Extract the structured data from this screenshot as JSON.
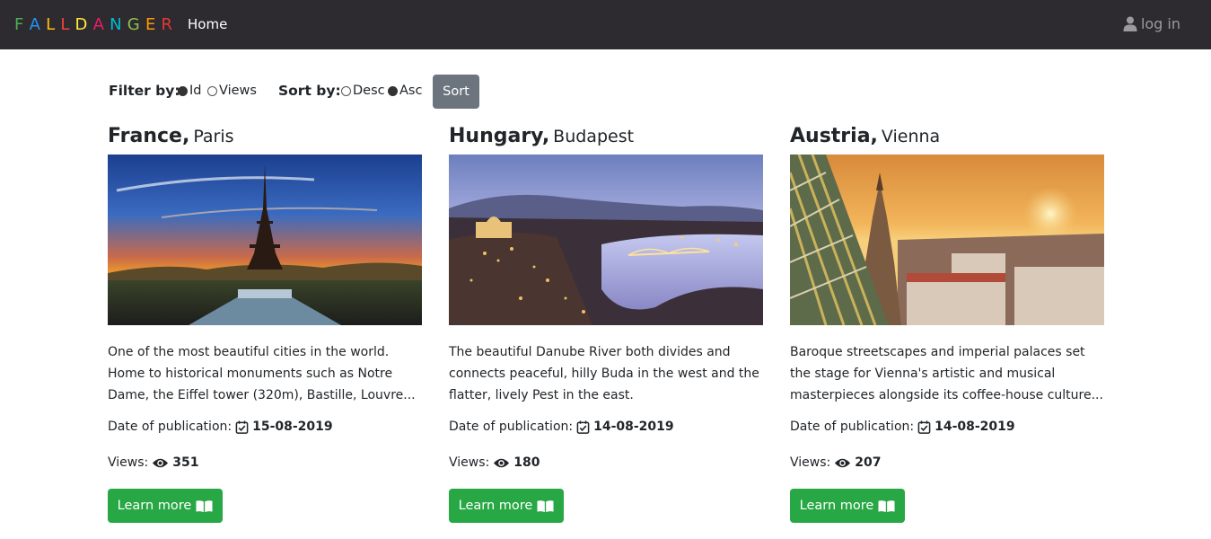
{
  "nav": {
    "brand_letters": [
      "F",
      "A",
      "L",
      "L",
      "D",
      "A",
      "N",
      "G",
      "E",
      "R"
    ],
    "brand_colors": [
      "#4caf50",
      "#2196f3",
      "#ffc107",
      "#f44336",
      "#ffeb3b",
      "#e91e63",
      "#00bcd4",
      "#8bc34a",
      "#ff9800",
      "#e53935"
    ],
    "home": "Home",
    "login": "log in",
    "login_icon": "user-icon"
  },
  "filter": {
    "filter_label": "Filter by:",
    "filter_options": [
      {
        "label": "Id",
        "checked": true
      },
      {
        "label": "Views",
        "checked": false
      }
    ],
    "sort_label": "Sort by:",
    "sort_options": [
      {
        "label": "Desc",
        "checked": false
      },
      {
        "label": "Asc",
        "checked": true
      }
    ],
    "sort_button": "Sort"
  },
  "cards": [
    {
      "country": "France,",
      "city": "Paris",
      "description": "One of the most beautiful cities in the world. Home to historical monuments such as Notre Dame, the Eiffel tower (320m), Bastille, Louvre...",
      "date_label": "Date of publication:",
      "date": "15-08-2019",
      "views_label": "Views:",
      "views": "351",
      "button": "Learn more"
    },
    {
      "country": "Hungary,",
      "city": "Budapest",
      "description": "The beautiful Danube River both divides and connects peaceful, hilly Buda in the west and the flatter, lively Pest in the east.",
      "date_label": "Date of publication:",
      "date": "14-08-2019",
      "views_label": "Views:",
      "views": "180",
      "button": "Learn more"
    },
    {
      "country": "Austria,",
      "city": "Vienna",
      "description": "Baroque streetscapes and imperial palaces set the stage for Vienna's artistic and musical masterpieces alongside its coffee-house culture...",
      "date_label": "Date of publication:",
      "date": "14-08-2019",
      "views_label": "Views:",
      "views": "207",
      "button": "Learn more"
    }
  ],
  "icons": {
    "date": "calendar-check-icon",
    "views": "eye-icon",
    "learn": "book-open-icon"
  },
  "colors": {
    "navbar": "#2d2b30",
    "sort_button": "#6c757d",
    "learn_button": "#28a745"
  }
}
